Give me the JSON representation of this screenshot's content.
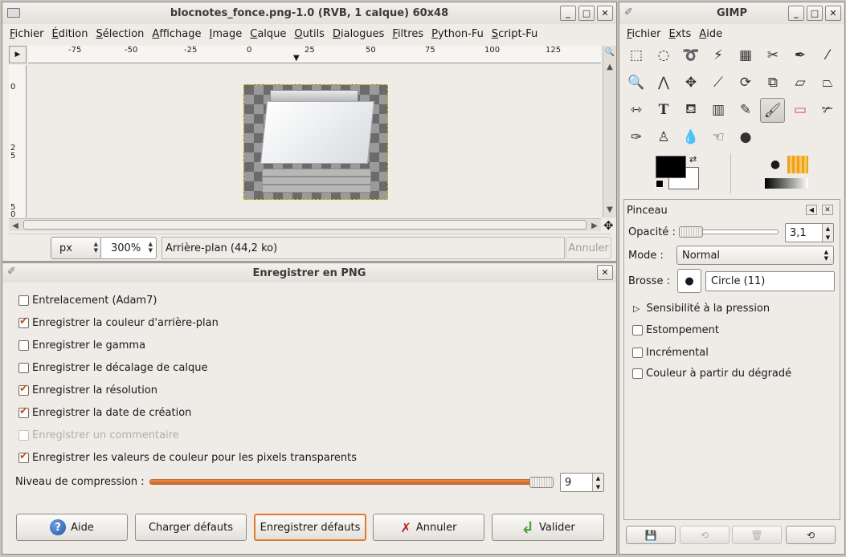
{
  "image_window": {
    "title": "blocnotes_fonce.png-1.0 (RVB, 1 calque) 60x48",
    "menu": [
      "Fichier",
      "Édition",
      "Sélection",
      "Affichage",
      "Image",
      "Calque",
      "Outils",
      "Dialogues",
      "Filtres",
      "Python-Fu",
      "Script-Fu"
    ],
    "hruler_labels": [
      "-75",
      "-50",
      "-25",
      "0",
      "25",
      "50",
      "75",
      "100",
      "125"
    ],
    "vruler_labels": [
      "0",
      "2",
      "5",
      "5",
      "0"
    ],
    "unit": "px",
    "zoom": "300%",
    "status": "Arrière-plan (44,2 ko)",
    "cancel_label": "Annuler"
  },
  "png_dialog": {
    "title": "Enregistrer en PNG",
    "options": [
      {
        "label": "Entrelacement (Adam7)",
        "checked": false,
        "enabled": true
      },
      {
        "label": "Enregistrer la couleur d'arrière-plan",
        "checked": true,
        "enabled": true
      },
      {
        "label": "Enregistrer le gamma",
        "checked": false,
        "enabled": true
      },
      {
        "label": "Enregistrer le décalage de calque",
        "checked": false,
        "enabled": true
      },
      {
        "label": "Enregistrer la résolution",
        "checked": true,
        "enabled": true
      },
      {
        "label": "Enregistrer la date de création",
        "checked": true,
        "enabled": true
      },
      {
        "label": "Enregistrer un commentaire",
        "checked": false,
        "enabled": false
      },
      {
        "label": "Enregistrer les valeurs de couleur pour les pixels transparents",
        "checked": true,
        "enabled": true
      }
    ],
    "compression_label": "Niveau de compression :",
    "compression_value": "9",
    "compression_fraction": 1.0,
    "buttons": {
      "help": "Aide",
      "load_defaults": "Charger défauts",
      "save_defaults": "Enregistrer défauts",
      "cancel": "Annuler",
      "ok": "Valider"
    }
  },
  "toolbox": {
    "title": "GIMP",
    "menu": [
      "Fichier",
      "Exts",
      "Aide"
    ],
    "tools": [
      "rect-select",
      "ellipse-select",
      "free-select",
      "fuzzy-select",
      "select-by-color",
      "scissors",
      "paths",
      "color-picker",
      "zoom",
      "measure",
      "move",
      "crop",
      "rotate",
      "scale",
      "shear",
      "perspective",
      "flip",
      "text",
      "bucket-fill",
      "blend",
      "pencil",
      "paintbrush",
      "eraser",
      "airbrush",
      "ink",
      "clone",
      "convolve",
      "smudge",
      "dodge-burn"
    ],
    "active_tool": "paintbrush",
    "fg_color": "#000000",
    "bg_color": "#ffffff",
    "panel": {
      "title": "Pinceau",
      "opacity_label": "Opacité :",
      "opacity_value": "3,1",
      "opacity_fraction": 0.031,
      "mode_label": "Mode :",
      "mode_value": "Normal",
      "brush_label": "Brosse :",
      "brush_value": "Circle (11)",
      "pressure_label": "Sensibilité à la pression",
      "fade_label": "Estompement",
      "incremental_label": "Incrémental",
      "gradient_label": "Couleur à partir du dégradé"
    }
  }
}
